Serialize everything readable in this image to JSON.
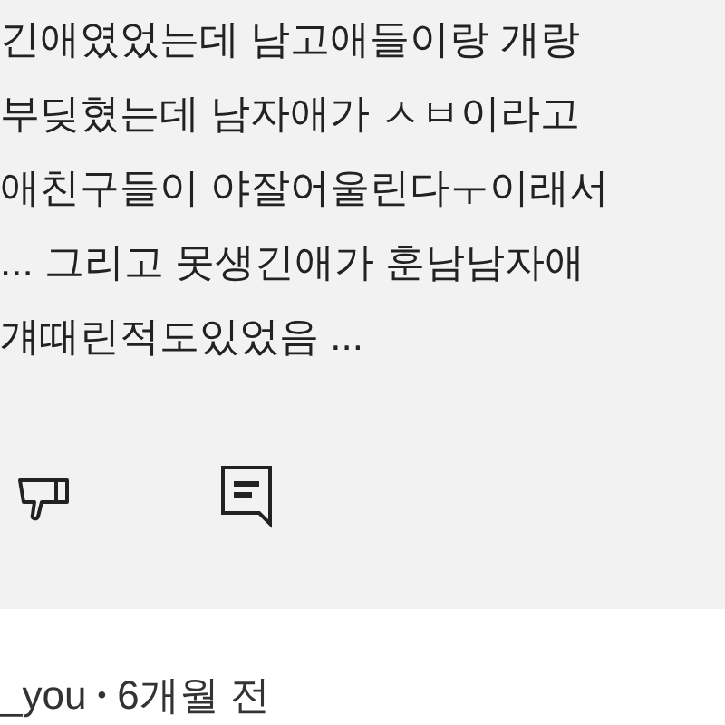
{
  "comment": {
    "lines": [
      "긴애였었는데 남고애들이랑 개랑",
      "부딪혔는데 남자애가 ㅅㅂ이라고",
      "애친구들이 야잘어울린다ㅜ이래서",
      "... 그리고 못생긴애가 훈남남자애",
      "걔때린적도있었음 ..."
    ]
  },
  "next_comment": {
    "author": "_you",
    "separator": "•",
    "time": "6개월 전"
  }
}
